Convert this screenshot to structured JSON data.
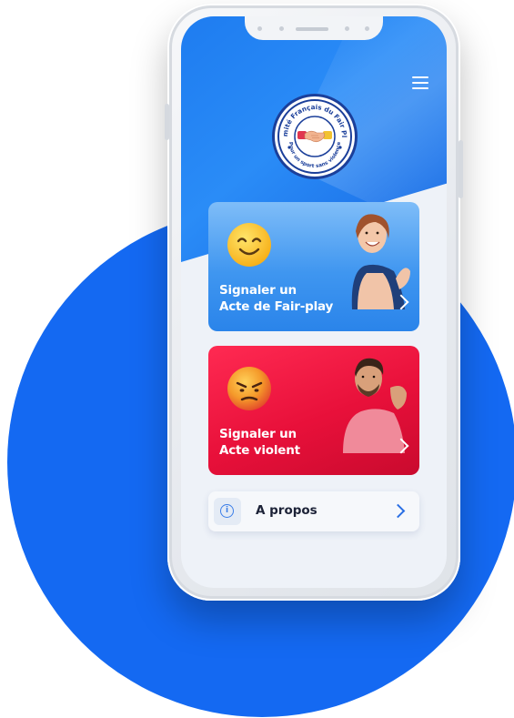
{
  "logo": {
    "top_text": "Comité Français du Fair Play",
    "bottom_text": "Pour un sport sans violence"
  },
  "header": {
    "menu_icon": "hamburger-menu-icon"
  },
  "cards": {
    "fair_play": {
      "line1": "Signaler un",
      "line2": "Acte de Fair-play",
      "emoji": "smiling-face-icon",
      "color": "#3f96f0"
    },
    "violent": {
      "line1": "Signaler un",
      "line2": "Acte violent",
      "emoji": "angry-face-icon",
      "color": "#e8103a"
    }
  },
  "about": {
    "label": "A propos",
    "icon": "info-icon",
    "info_glyph": "i"
  },
  "colors": {
    "brand_blue": "#1469f2",
    "background": "#ffffff"
  }
}
